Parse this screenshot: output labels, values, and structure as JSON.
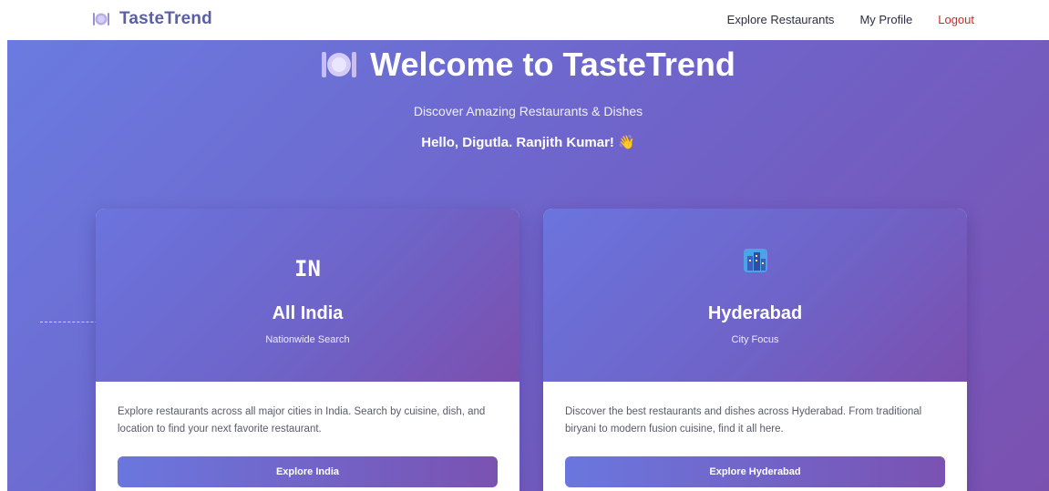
{
  "navbar": {
    "brand": "TasteTrend",
    "brand_icon": "plate-icon",
    "links": [
      "Explore Restaurants",
      "My Profile",
      "Logout"
    ]
  },
  "hero": {
    "title": "Welcome to TasteTrend",
    "subtitle": "Discover Amazing Restaurants & Dishes",
    "greeting": "Hello, Digutla. Ranjith Kumar! 👋"
  },
  "cards": [
    {
      "badge": "IN",
      "title": "All India",
      "subtitle": "Nationwide Search",
      "description": "Explore restaurants across all major cities in India. Search by cuisine, dish, and location to find your next favorite restaurant.",
      "button": "Explore India"
    },
    {
      "icon": "city-icon",
      "title": "Hyderabad",
      "subtitle": "City Focus",
      "description": "Discover the best restaurants and dishes across Hyderabad. From traditional biryani to modern fusion cuisine, find it all here.",
      "button": "Explore Hyderabad"
    }
  ],
  "colors": {
    "brand": "#5b5fa3",
    "hero_start": "#6a7be0",
    "hero_end": "#7b51b0",
    "logout": "#d0282a"
  }
}
